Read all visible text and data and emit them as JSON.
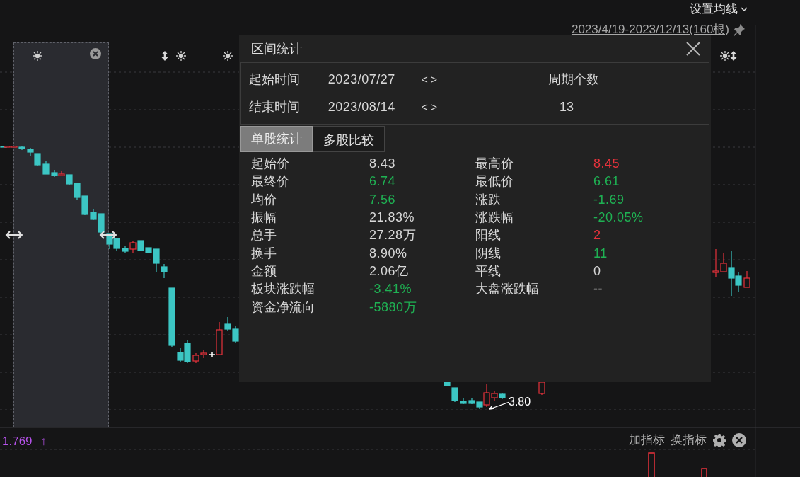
{
  "header": {
    "ma_setting": "设置均线",
    "range": "2023/4/19-2023/12/13(160根)"
  },
  "chart": {
    "low_label": "3.80"
  },
  "dialog": {
    "title": "区间统计",
    "rows": [
      {
        "label": "起始时间",
        "value": "2023/07/27",
        "prev": "<",
        "next": ">",
        "extra_label": "周期个数"
      },
      {
        "label": "结束时间",
        "value": "2023/08/14",
        "prev": "<",
        "next": ">",
        "extra_value": "13"
      }
    ],
    "tabs": [
      {
        "label": "单股统计",
        "selected": true
      },
      {
        "label": "多股比较",
        "selected": false
      }
    ],
    "left_stats": [
      {
        "label": "起始价",
        "value": "8.43",
        "color": "#d8d8d8"
      },
      {
        "label": "最终价",
        "value": "6.74",
        "color": "#1fb153"
      },
      {
        "label": "均价",
        "value": "7.56",
        "color": "#1fb153"
      },
      {
        "label": "振幅",
        "value": "21.83%",
        "color": "#d8d8d8"
      },
      {
        "label": "总手",
        "value": "27.28万",
        "color": "#d8d8d8"
      },
      {
        "label": "换手",
        "value": "8.90%",
        "color": "#d8d8d8"
      },
      {
        "label": "金额",
        "value": "2.06亿",
        "color": "#d8d8d8"
      },
      {
        "label": "板块涨跌幅",
        "value": "-3.41%",
        "color": "#1fb153"
      },
      {
        "label": "资金净流向",
        "value": "-5880万",
        "color": "#1fb153"
      }
    ],
    "right_stats": [
      {
        "label": "最高价",
        "value": "8.45",
        "color": "#e8323c"
      },
      {
        "label": "最低价",
        "value": "6.61",
        "color": "#1fb153"
      },
      {
        "label": "涨跌",
        "value": "-1.69",
        "color": "#1fb153"
      },
      {
        "label": "涨跌幅",
        "value": "-20.05%",
        "color": "#1fb153"
      },
      {
        "label": "阳线",
        "value": "2",
        "color": "#e8323c"
      },
      {
        "label": "阴线",
        "value": "11",
        "color": "#1fb153"
      },
      {
        "label": "平线",
        "value": "0",
        "color": "#d8d8d8"
      },
      {
        "label": "大盘涨跌幅",
        "value": "--",
        "color": "#d8d8d8"
      }
    ]
  },
  "indicator_bar": {
    "value": "1.769",
    "arrow": "↑",
    "add": "加指标",
    "switch": "换指标"
  }
}
